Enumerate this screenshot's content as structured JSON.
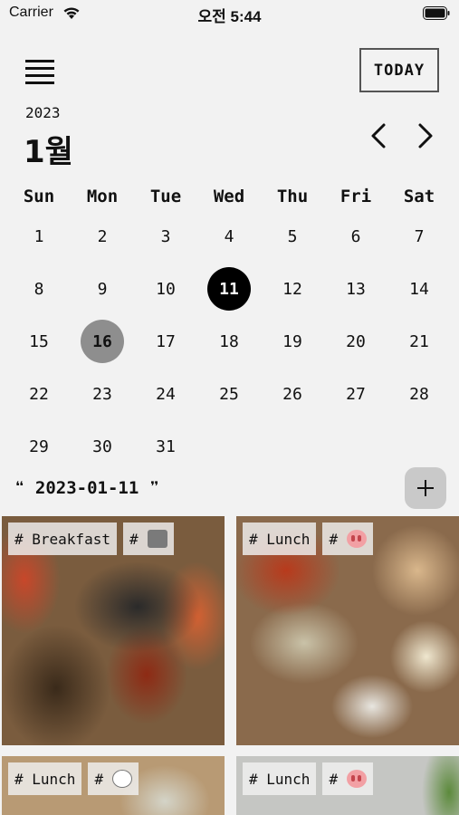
{
  "status_bar": {
    "carrier": "Carrier",
    "time": "오전 5:44"
  },
  "header": {
    "today_label": "TODAY",
    "year": "2023",
    "month": "1월"
  },
  "weekdays": [
    "Sun",
    "Mon",
    "Tue",
    "Wed",
    "Thu",
    "Fri",
    "Sat"
  ],
  "days": [
    "1",
    "2",
    "3",
    "4",
    "5",
    "6",
    "7",
    "8",
    "9",
    "10",
    "11",
    "12",
    "13",
    "14",
    "15",
    "16",
    "17",
    "18",
    "19",
    "20",
    "21",
    "22",
    "23",
    "24",
    "25",
    "26",
    "27",
    "28",
    "29",
    "30",
    "31"
  ],
  "selected_day": "11",
  "current_day": "16",
  "selected_date": "2023-01-11",
  "quote_open": "❝",
  "quote_close": "❞",
  "meals": [
    {
      "tag": "# Breakfast",
      "mood_prefix": "#",
      "mood_icon": "gray-square-icon"
    },
    {
      "tag": "# Lunch",
      "mood_prefix": "#",
      "mood_icon": "pig-face-icon"
    },
    {
      "tag": "# Lunch",
      "mood_prefix": "#",
      "mood_icon": "ghost-face-icon"
    },
    {
      "tag": "# Lunch",
      "mood_prefix": "#",
      "mood_icon": "pig-face-icon"
    }
  ],
  "colors": {
    "background": "#f2f2f2",
    "selected_day": "#000000",
    "current_day": "#8e8e8e",
    "add_button": "#c9c9c9"
  }
}
